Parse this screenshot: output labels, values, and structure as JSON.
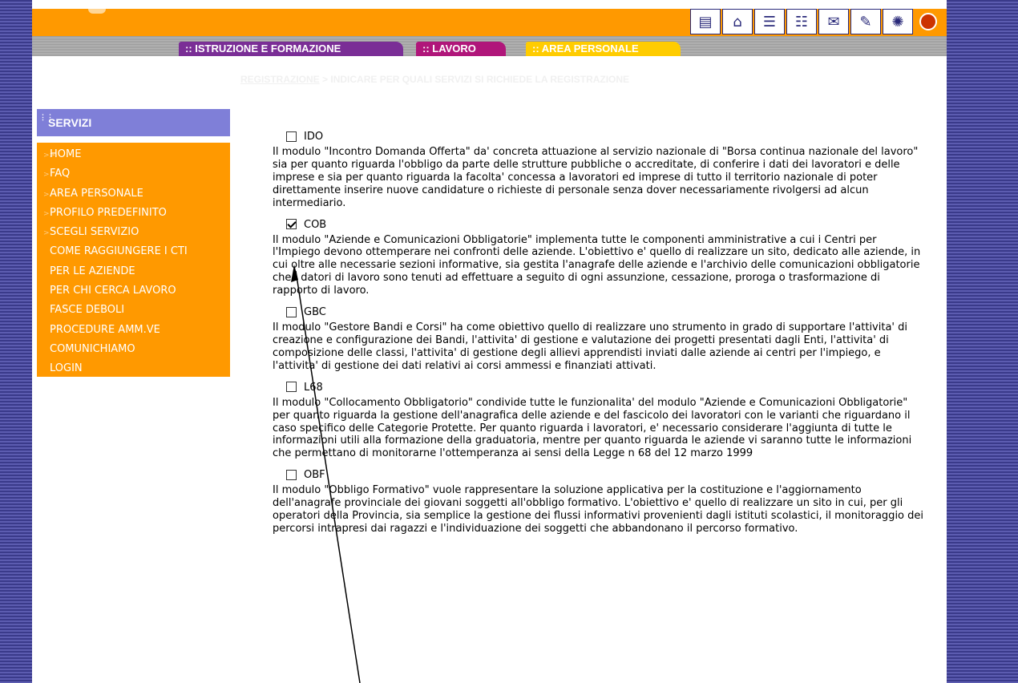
{
  "header": {
    "icons": [
      "document-icon",
      "home-icon",
      "search-doc-icon",
      "sitemap-icon",
      "mail-icon",
      "notepad-icon",
      "accessibility-icon",
      "globe-icon"
    ]
  },
  "tabs": [
    {
      "label": ":: ISTRUZIONE E FORMAZIONE"
    },
    {
      "label": ":: LAVORO"
    },
    {
      "label": ":: AREA PERSONALE"
    }
  ],
  "breadcrumb": {
    "link": "REGISTRAZIONE",
    "separator": " > ",
    "current": "INDICARE PER QUALI SERVIZI SI RICHIEDE LA REGISTRAZIONE"
  },
  "menu": {
    "title": "SERVIZI",
    "items": [
      {
        "label": "HOME",
        "arrow": ">>"
      },
      {
        "label": "FAQ",
        "arrow": ">"
      },
      {
        "label": "AREA PERSONALE",
        "arrow": ">"
      },
      {
        "label": "PROFILO PREDEFINITO",
        "arrow": ">"
      },
      {
        "label": "SCEGLI SERVIZIO",
        "arrow": ">"
      },
      {
        "label": "COME RAGGIUNGERE I CTI",
        "arrow": ""
      },
      {
        "label": "PER LE AZIENDE",
        "arrow": ""
      },
      {
        "label": "PER CHI CERCA LAVORO",
        "arrow": ""
      },
      {
        "label": "FASCE DEBOLI",
        "arrow": ""
      },
      {
        "label": "PROCEDURE AMM.VE",
        "arrow": ""
      },
      {
        "label": "COMUNICHIAMO",
        "arrow": ""
      },
      {
        "label": "LOGIN",
        "arrow": ""
      }
    ]
  },
  "services": [
    {
      "code": "IDO",
      "checked": false,
      "description": "Il modulo \"Incontro Domanda Offerta\" da' concreta attuazione al servizio nazionale di \"Borsa continua nazionale del lavoro\" sia per quanto riguarda l'obbligo da parte delle strutture pubbliche o accreditate, di conferire i dati dei lavoratori e delle imprese e sia per quanto riguarda la facolta' concessa a lavoratori ed imprese di tutto il territorio nazionale di poter direttamente inserire nuove candidature o richieste di personale senza dover necessariamente rivolgersi ad alcun intermediario."
    },
    {
      "code": "COB",
      "checked": true,
      "description": "Il modulo \"Aziende e Comunicazioni Obbligatorie\" implementa tutte le componenti amministrative a cui i Centri per l'Impiego devono ottemperare nei confronti delle aziende. L'obiettivo e' quello di realizzare un sito, dedicato alle aziende, in cui oltre alle necessarie sezioni informative, sia gestita l'anagrafe delle aziende e l'archivio delle comunicazioni obbligatorie che i datori di lavoro sono tenuti ad effettuare a seguito di ogni assunzione, cessazione, proroga o trasformazione di rapporto di lavoro."
    },
    {
      "code": "GBC",
      "checked": false,
      "description": "Il modulo \"Gestore Bandi e Corsi\" ha come obiettivo quello di realizzare uno strumento in grado di supportare l'attivita' di creazione e configurazione dei Bandi, l'attivita' di gestione e valutazione dei progetti presentati dagli Enti, l'attivita' di composizione delle classi, l'attivita' di gestione degli allievi apprendisti inviati dalle aziende ai centri per l'impiego, e l'attivita' di gestione dei dati relativi ai corsi ammessi e finanziati attivati."
    },
    {
      "code": "L68",
      "checked": false,
      "description": "Il modulo \"Collocamento Obbligatorio\" condivide tutte le funzionalita' del modulo \"Aziende e Comunicazioni Obbligatorie\" per quanto riguarda la gestione dell'anagrafica delle aziende e del fascicolo dei lavoratori con le varianti che riguardano il caso specifico delle Categorie Protette. Per quanto riguarda i lavoratori, e' necessario considerare l'aggiunta di tutte le informazioni utili alla formazione della graduatoria, mentre per quanto riguarda le aziende vi saranno tutte le informazioni che permettano di monitorarne l'ottemperanza ai sensi della Legge n 68 del 12 marzo 1999"
    },
    {
      "code": "OBF",
      "checked": false,
      "description": "Il modulo \"Obbligo Formativo\" vuole rappresentare la soluzione applicativa per la costituzione e l'aggiornamento dell'anagrafe provinciale dei giovani soggetti all'obbligo formativo. L'obiettivo e' quello di realizzare un sito in cui, per gli operatori della Provincia, sia semplice la gestione dei flussi informativi provenienti dagli istituti scolastici, il monitoraggio dei percorsi intrapresi dai ragazzi e l'individuazione dei soggetti che abbandonano il percorso formativo."
    }
  ]
}
